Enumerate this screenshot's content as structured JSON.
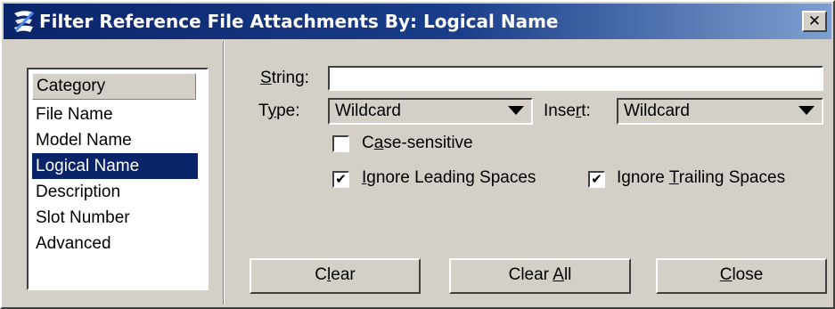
{
  "window": {
    "title": "Filter Reference File Attachments By: Logical Name"
  },
  "categories": {
    "header": "Category",
    "items": [
      "File Name",
      "Model Name",
      "Logical Name",
      "Description",
      "Slot Number",
      "Advanced"
    ],
    "selected": "Logical Name"
  },
  "string_field": {
    "label_hot": "S",
    "label_rest": "tring:",
    "value": ""
  },
  "type_field": {
    "label_a": "T",
    "label_hot": "y",
    "label_b": "pe:",
    "value": "Wildcard"
  },
  "insert_field": {
    "label_a": "Inse",
    "label_hot": "r",
    "label_b": "t:",
    "value": "Wildcard"
  },
  "checkboxes": {
    "case_sensitive": {
      "label_a": "C",
      "label_hot": "a",
      "label_b": "se-sensitive",
      "checked": false
    },
    "ignore_leading": {
      "label_a": "",
      "label_hot": "I",
      "label_b": "gnore Leading Spaces",
      "checked": true
    },
    "ignore_trailing": {
      "label_a": "Ignore ",
      "label_hot": "T",
      "label_b": "railing Spaces",
      "checked": true
    }
  },
  "buttons": {
    "clear": {
      "label_a": "C",
      "label_hot": "l",
      "label_b": "ear"
    },
    "clear_all": {
      "label_a": "Clear ",
      "label_hot": "A",
      "label_b": "ll"
    },
    "close": {
      "label_a": "",
      "label_hot": "C",
      "label_b": "lose"
    }
  },
  "check_mark": "✔",
  "close_glyph": "✕",
  "icons": [
    "app-icon",
    "close-icon",
    "dropdown-arrow-icon",
    "checkbox-icon"
  ]
}
